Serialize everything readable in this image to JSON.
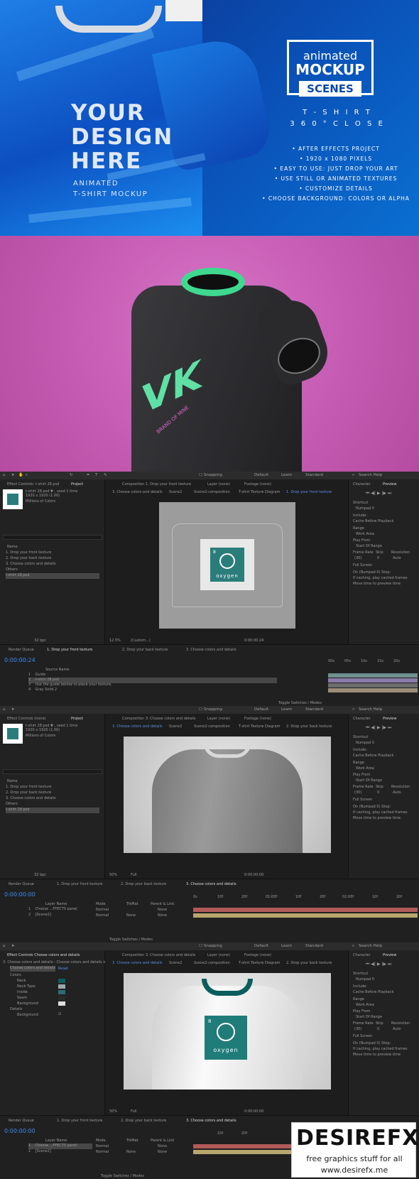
{
  "hero": {
    "headline": [
      "YOUR",
      "DESIGN",
      "HERE"
    ],
    "sub": [
      "ANIMATED",
      "T-SHIRT MOCKUP"
    ],
    "logo": {
      "line1": "animated",
      "line2": "MOCKUP",
      "line3": "SCENES"
    },
    "title": [
      "T - S H I R T",
      "3 6 0 °  C L O S E"
    ],
    "features": [
      "• AFTER EFFECTS PROJECT",
      "• 1920 x 1080 PIXELS",
      "• EASY TO USE: JUST DROP YOUR ART",
      "• USE STILL OR ANIMATED TEXTURES",
      "• CUSTOMIZE DETAILS",
      "• CHOOSE BACKGROUND: COLORS OR ALPHA"
    ],
    "brand_blue": "#0a4fbf"
  },
  "dark_shirt": {
    "bg_color": "#c95fb6",
    "collar_color": "#3ed98f",
    "logo_text": "VK",
    "logo_subtext": "BRAND OF MINE"
  },
  "ae1": {
    "menu": [
      "Snapping",
      "Default",
      "Learn",
      "Standard",
      "Search Help"
    ],
    "effect_controls": "Effect Controls: t-shirt 28.psd",
    "project_tab": "Project",
    "file_name": "t-shirt 28.psd ▼ , used 1 time",
    "file_info": "1920 x 1920 (1.00)",
    "file_colors": "Millions of Colors",
    "name_header": "Name",
    "items": [
      "1. Drop your front texture",
      "2. Drop your back texture",
      "3. Choose colors and details",
      "Others",
      "t-shirt 28.psd"
    ],
    "bpc": "32 bpc",
    "comp_tab": "Composition 1. Drop your front texture",
    "layer_tab": "Layer (none)",
    "footage_tab": "Footage (none)",
    "breadcrumbs": [
      "3. Choose colors and details",
      "Scene2",
      "Scene2-composition",
      "T-shirt Texture Diagram",
      "1. Drop your front texture"
    ],
    "canvas_text": "oxygen",
    "canvas_letter": "8",
    "zoom": "12.5%",
    "res": "(Custom...)",
    "timecode_small": "0:00:00:24",
    "preview_tabs": [
      "Character",
      "Preview"
    ],
    "shortcut_label": "Shortcut",
    "shortcut_value": "Numpad 0",
    "include_label": "Include:",
    "cache_label": "Cache Before Playback",
    "range_label": "Range",
    "range_value": "Work Area",
    "play_from_label": "Play From",
    "play_from_value": "Start Of Range",
    "frame_rate_label": "Frame Rate",
    "skip_label": "Skip",
    "resolution_label": "Resolution",
    "frame_rate_value": "(30)",
    "skip_value": "0",
    "resolution_value": "Auto",
    "fullscreen_label": "Full Screen",
    "on_stop_label": "On (Numpad 0) Stop:",
    "if_caching_label": "If caching, play cached frames",
    "move_time_label": "Move time to preview time",
    "tl_tabs": [
      "Render Queue",
      "1. Drop your front texture",
      "2. Drop your back texture",
      "3. Choose colors and details"
    ],
    "timecode": "0:00:00:24",
    "source_header": "Source Name",
    "layers": [
      {
        "num": "1",
        "name": "Guide"
      },
      {
        "num": "2",
        "name": "t-shirt 28.psd"
      },
      {
        "num": "3",
        "name": "Use the guide bellow to place your texture."
      },
      {
        "num": "4",
        "name": "Gray Solid 2"
      }
    ],
    "ticks": [
      "00s",
      "05s",
      "10s",
      "15s",
      "20s"
    ],
    "toggle": "Toggle Switches / Modes"
  },
  "ae2": {
    "effect_controls": "Effect Controls (none)",
    "project_tab": "Project",
    "file_name": "t-shirt 28.psd ▼ , used 1 time",
    "file_info": "1920 x 1920 (1.00)",
    "file_colors": "Millions of Colors",
    "name_header": "Name",
    "items": [
      "1. Drop your front texture",
      "2. Drop your back texture",
      "3. Choose colors and details",
      "Others",
      "t-shirt 28.psd"
    ],
    "bpc": "32 bpc",
    "comp_tab": "Composition 3. Choose colors and details",
    "layer_tab": "Layer (none)",
    "footage_tab": "Footage (none)",
    "breadcrumbs": [
      "3. Choose colors and details",
      "Scene2",
      "Scene2-composition",
      "T-shirt Texture Diagram",
      "2. Drop your back texture"
    ],
    "zoom": "50%",
    "res": "Full",
    "timecode_small": "0:00:00:00",
    "tl_tabs": [
      "Render Queue",
      "1. Drop your front texture",
      "2. Drop your back texture",
      "3. Choose colors and details"
    ],
    "timecode": "0:00:00:00",
    "layer_header": "Layer Name",
    "mode_header": "Mode",
    "trkmat_header": "TrkMat",
    "parent_header": "Parent & Link",
    "layers": [
      {
        "num": "1",
        "name": "Choose ...FFECTS panel.",
        "mode": "Normal",
        "parent": "None"
      },
      {
        "num": "2",
        "name": "[Scene2]",
        "mode": "Normal",
        "trk": "None",
        "parent": "None"
      }
    ],
    "ticks": [
      "0s",
      "10f",
      "20f",
      "01:00f",
      "10f",
      "20f",
      "02:00f",
      "10f",
      "20f"
    ],
    "toggle": "Toggle Switches / Modes"
  },
  "ae3": {
    "effect_controls": "Effect Controls Choose colors and details",
    "breadcrumb_fx": "3. Choose colors and details - Choose colors and details in the Ef",
    "fx_name": "Choose colors and details",
    "fx_reset": "Reset",
    "props": [
      "Colors",
      "Neck",
      "Neck Type",
      "Inside",
      "Seam",
      "Background",
      "Details",
      "Background"
    ],
    "comp_tab": "Composition 3. Choose colors and details",
    "layer_tab": "Layer (none)",
    "footage_tab": "Footage (none)",
    "breadcrumbs": [
      "3. Choose colors and details",
      "Scene2",
      "Scene2-composition",
      "T-shirt Texture Diagram",
      "2. Drop your back texture"
    ],
    "canvas_text": "oxygen",
    "canvas_letter": "8",
    "zoom": "50%",
    "res": "Full",
    "timecode_small": "0:00:00:00",
    "tl_tabs": [
      "Render Queue",
      "1. Drop your front texture",
      "2. Drop your back texture",
      "3. Choose colors and details"
    ],
    "timecode": "0:00:00:00",
    "layers": [
      {
        "num": "1",
        "name": "Choose ...FFECTS panel.",
        "mode": "Normal",
        "parent": "None"
      },
      {
        "num": "2",
        "name": "[Scene2]",
        "mode": "Normal",
        "trk": "None",
        "parent": "None"
      }
    ],
    "toggle": "Toggle Switches / Modes",
    "neck_color": "#0b5e5e"
  },
  "watermark": {
    "name": "DESIREFX",
    "line1": "free graphics stuff for all",
    "line2": "www.desirefx.me"
  }
}
